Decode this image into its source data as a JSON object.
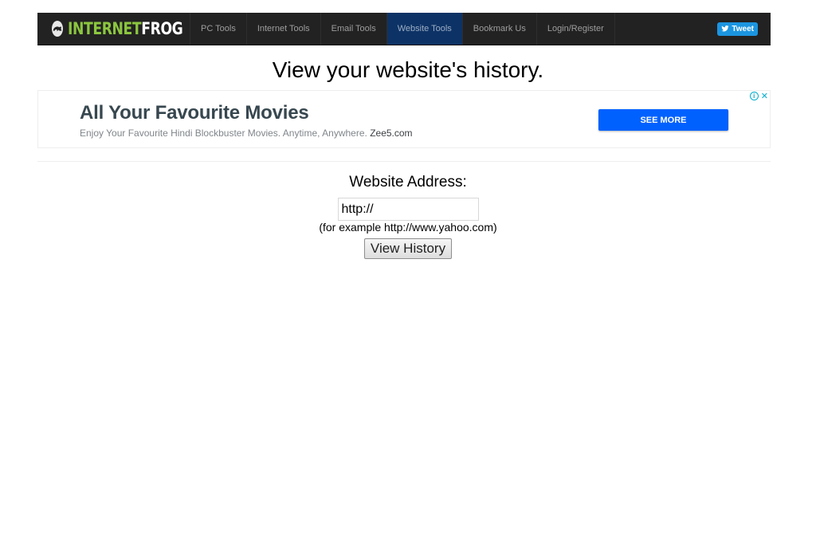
{
  "navbar": {
    "logo": {
      "part1": "INTERNET",
      "part2": "FROG",
      "icon": "frog-icon"
    },
    "items": [
      {
        "label": "PC Tools",
        "active": false
      },
      {
        "label": "Internet Tools",
        "active": false
      },
      {
        "label": "Email Tools",
        "active": false
      },
      {
        "label": "Website Tools",
        "active": true
      },
      {
        "label": "Bookmark Us",
        "active": false
      },
      {
        "label": "Login/Register",
        "active": false
      }
    ],
    "tweet": {
      "label": "Tweet",
      "icon": "twitter-bird-icon"
    }
  },
  "page": {
    "title": "View your website's history."
  },
  "ad": {
    "headline": "All Your Favourite Movies",
    "description": "Enjoy Your Favourite Hindi Blockbuster Movies. Anytime, Anywhere.",
    "domain": "Zee5.com",
    "cta": "SEE MORE",
    "info_glyph": "i",
    "close_glyph": "✕",
    "colors": {
      "cta": "#0061ff",
      "controls": "#00aecd"
    }
  },
  "form": {
    "label": "Website Address:",
    "input_value": "http://",
    "hint": "(for example http://www.yahoo.com)",
    "submit_label": "View History"
  },
  "colors": {
    "nav_bg": "#222222",
    "nav_active": "#0d3366",
    "logo_green": "#8cc63f",
    "tweet": "#1b95e0"
  }
}
